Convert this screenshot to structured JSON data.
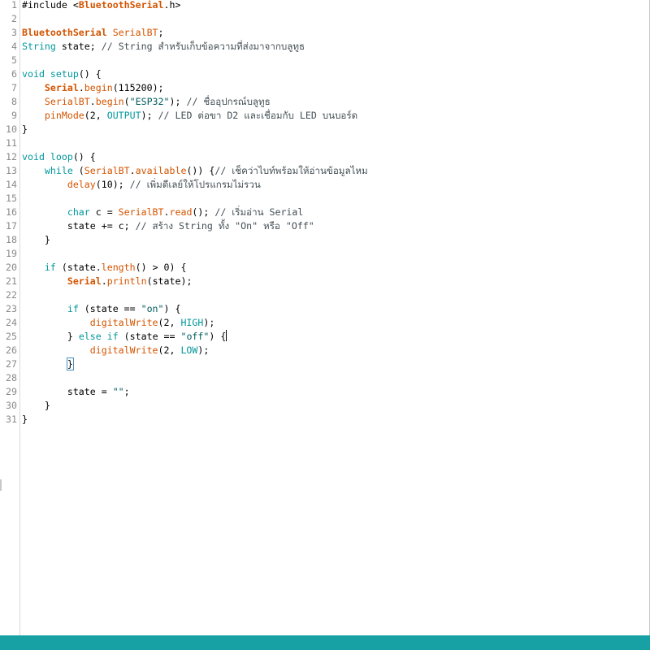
{
  "editor": {
    "lines": [
      {
        "n": "1",
        "tokens": [
          {
            "t": "#include <",
            "c": "txt"
          },
          {
            "t": "BluetoothSerial",
            "c": "bold"
          },
          {
            "t": ".h>",
            "c": "txt"
          }
        ]
      },
      {
        "n": "2",
        "tokens": []
      },
      {
        "n": "3",
        "tokens": [
          {
            "t": "BluetoothSerial",
            "c": "bold"
          },
          {
            "t": " ",
            "c": "txt"
          },
          {
            "t": "SerialBT",
            "c": "fn"
          },
          {
            "t": ";",
            "c": "txt"
          }
        ]
      },
      {
        "n": "4",
        "tokens": [
          {
            "t": "String",
            "c": "kw"
          },
          {
            "t": " state; ",
            "c": "txt"
          },
          {
            "t": "// String สำหรับเก็บข้อความที่ส่งมาจากบลูทูธ",
            "c": "cm"
          }
        ]
      },
      {
        "n": "5",
        "tokens": []
      },
      {
        "n": "6",
        "tokens": [
          {
            "t": "void",
            "c": "kw"
          },
          {
            "t": " ",
            "c": "txt"
          },
          {
            "t": "setup",
            "c": "kw"
          },
          {
            "t": "() {",
            "c": "txt"
          }
        ]
      },
      {
        "n": "7",
        "tokens": [
          {
            "t": "    ",
            "c": "txt"
          },
          {
            "t": "Serial",
            "c": "bold"
          },
          {
            "t": ".",
            "c": "txt"
          },
          {
            "t": "begin",
            "c": "fn"
          },
          {
            "t": "(115200);",
            "c": "txt"
          }
        ]
      },
      {
        "n": "8",
        "tokens": [
          {
            "t": "    ",
            "c": "txt"
          },
          {
            "t": "SerialBT",
            "c": "fn"
          },
          {
            "t": ".",
            "c": "txt"
          },
          {
            "t": "begin",
            "c": "fn"
          },
          {
            "t": "(",
            "c": "txt"
          },
          {
            "t": "\"ESP32\"",
            "c": "str"
          },
          {
            "t": "); ",
            "c": "txt"
          },
          {
            "t": "// ชื่ออุปกรณ์บลูทูธ",
            "c": "cm"
          }
        ]
      },
      {
        "n": "9",
        "tokens": [
          {
            "t": "    ",
            "c": "txt"
          },
          {
            "t": "pinMode",
            "c": "fn"
          },
          {
            "t": "(2, ",
            "c": "txt"
          },
          {
            "t": "OUTPUT",
            "c": "const"
          },
          {
            "t": "); ",
            "c": "txt"
          },
          {
            "t": "// LED ต่อขา D2 และเชื่อมกับ LED บนบอร์ด",
            "c": "cm"
          }
        ]
      },
      {
        "n": "10",
        "tokens": [
          {
            "t": "}",
            "c": "txt"
          }
        ]
      },
      {
        "n": "11",
        "tokens": []
      },
      {
        "n": "12",
        "tokens": [
          {
            "t": "void",
            "c": "kw"
          },
          {
            "t": " ",
            "c": "txt"
          },
          {
            "t": "loop",
            "c": "kw"
          },
          {
            "t": "() {",
            "c": "txt"
          }
        ]
      },
      {
        "n": "13",
        "tokens": [
          {
            "t": "    ",
            "c": "txt"
          },
          {
            "t": "while",
            "c": "kw"
          },
          {
            "t": " (",
            "c": "txt"
          },
          {
            "t": "SerialBT",
            "c": "fn"
          },
          {
            "t": ".",
            "c": "txt"
          },
          {
            "t": "available",
            "c": "fn"
          },
          {
            "t": "()) {",
            "c": "txt"
          },
          {
            "t": "// เช็คว่าไบท์พร้อมให้อ่านข้อมูลไหม",
            "c": "cm"
          }
        ]
      },
      {
        "n": "14",
        "tokens": [
          {
            "t": "        ",
            "c": "txt"
          },
          {
            "t": "delay",
            "c": "fn"
          },
          {
            "t": "(10); ",
            "c": "txt"
          },
          {
            "t": "// เพิ่มดีเลย์ให้โปรแกรมไม่รวน",
            "c": "cm"
          }
        ]
      },
      {
        "n": "15",
        "tokens": []
      },
      {
        "n": "16",
        "tokens": [
          {
            "t": "        ",
            "c": "txt"
          },
          {
            "t": "char",
            "c": "kw"
          },
          {
            "t": " c = ",
            "c": "txt"
          },
          {
            "t": "SerialBT",
            "c": "fn"
          },
          {
            "t": ".",
            "c": "txt"
          },
          {
            "t": "read",
            "c": "fn"
          },
          {
            "t": "(); ",
            "c": "txt"
          },
          {
            "t": "// เริ่มอ่าน Serial",
            "c": "cm"
          }
        ]
      },
      {
        "n": "17",
        "tokens": [
          {
            "t": "        state += c; ",
            "c": "txt"
          },
          {
            "t": "// สร้าง String ทั้ง \"On\" หรือ \"Off\"",
            "c": "cm"
          }
        ]
      },
      {
        "n": "18",
        "tokens": [
          {
            "t": "    }",
            "c": "txt"
          }
        ]
      },
      {
        "n": "19",
        "tokens": []
      },
      {
        "n": "20",
        "tokens": [
          {
            "t": "    ",
            "c": "txt"
          },
          {
            "t": "if",
            "c": "kw"
          },
          {
            "t": " (state.",
            "c": "txt"
          },
          {
            "t": "length",
            "c": "fn"
          },
          {
            "t": "() > 0) {",
            "c": "txt"
          }
        ]
      },
      {
        "n": "21",
        "tokens": [
          {
            "t": "        ",
            "c": "txt"
          },
          {
            "t": "Serial",
            "c": "bold"
          },
          {
            "t": ".",
            "c": "txt"
          },
          {
            "t": "println",
            "c": "fn"
          },
          {
            "t": "(state);",
            "c": "txt"
          }
        ]
      },
      {
        "n": "22",
        "tokens": []
      },
      {
        "n": "23",
        "tokens": [
          {
            "t": "        ",
            "c": "txt"
          },
          {
            "t": "if",
            "c": "kw"
          },
          {
            "t": " (state == ",
            "c": "txt"
          },
          {
            "t": "\"on\"",
            "c": "str"
          },
          {
            "t": ") {",
            "c": "txt"
          }
        ]
      },
      {
        "n": "24",
        "tokens": [
          {
            "t": "            ",
            "c": "txt"
          },
          {
            "t": "digitalWrite",
            "c": "fn"
          },
          {
            "t": "(2, ",
            "c": "txt"
          },
          {
            "t": "HIGH",
            "c": "const"
          },
          {
            "t": ");",
            "c": "txt"
          }
        ]
      },
      {
        "n": "25",
        "tokens": [
          {
            "t": "        } ",
            "c": "txt"
          },
          {
            "t": "else",
            "c": "kw"
          },
          {
            "t": " ",
            "c": "txt"
          },
          {
            "t": "if",
            "c": "kw"
          },
          {
            "t": " (state == ",
            "c": "txt"
          },
          {
            "t": "\"off\"",
            "c": "str"
          },
          {
            "t": ") {",
            "c": "txt"
          },
          {
            "t": "",
            "c": "caret"
          }
        ]
      },
      {
        "n": "26",
        "tokens": [
          {
            "t": "            ",
            "c": "txt"
          },
          {
            "t": "digitalWrite",
            "c": "fn"
          },
          {
            "t": "(2, ",
            "c": "txt"
          },
          {
            "t": "LOW",
            "c": "const"
          },
          {
            "t": ");",
            "c": "txt"
          }
        ]
      },
      {
        "n": "27",
        "tokens": [
          {
            "t": "        ",
            "c": "txt"
          },
          {
            "t": "}",
            "c": "bracket"
          }
        ]
      },
      {
        "n": "28",
        "tokens": []
      },
      {
        "n": "29",
        "tokens": [
          {
            "t": "        state = ",
            "c": "txt"
          },
          {
            "t": "\"\"",
            "c": "str"
          },
          {
            "t": ";",
            "c": "txt"
          }
        ]
      },
      {
        "n": "30",
        "tokens": [
          {
            "t": "    }",
            "c": "txt"
          }
        ]
      },
      {
        "n": "31",
        "tokens": [
          {
            "t": "}",
            "c": "txt"
          }
        ]
      }
    ]
  },
  "colors": {
    "keyword": "#00979c",
    "function": "#d35400",
    "comment": "#434f54",
    "string": "#005c5f",
    "statusbar": "#17a1a5"
  }
}
